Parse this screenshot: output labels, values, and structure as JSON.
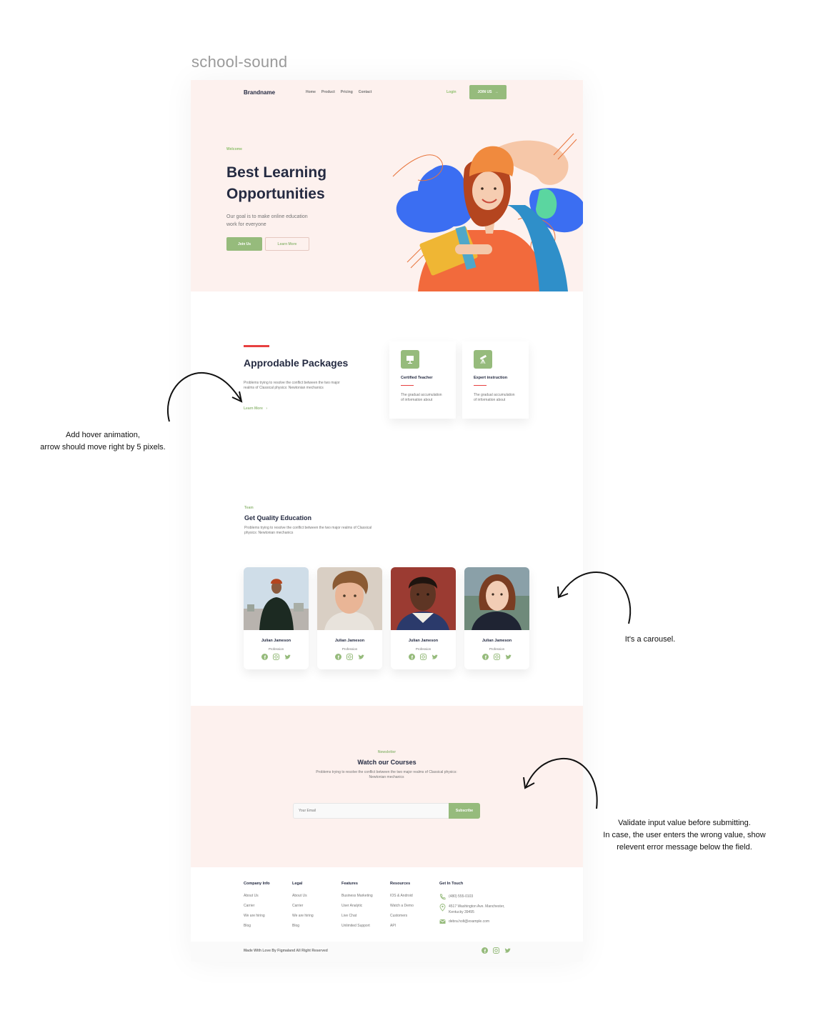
{
  "project_title": "school-sound",
  "header": {
    "brand": "Brandname",
    "nav": [
      "Home",
      "Product",
      "Pricing",
      "Contact"
    ],
    "login": "Login",
    "join_label": "JOIN US",
    "join_arrow": "→"
  },
  "hero": {
    "tag": "Welcome",
    "title_line1": "Best Learning",
    "title_line2": "Opportunities",
    "subtitle": "Our goal is to make online education work for everyone",
    "primary_button": "Join Us",
    "secondary_button": "Learn More"
  },
  "packages": {
    "title": "Approdable Packages",
    "subtitle": "Problems trying to resolve the conflict between the two major realms of Classical physics: Newtonian mechanics",
    "link": "Learn More",
    "link_arrow": "›",
    "cards": [
      {
        "icon": "presentation-board-icon",
        "title": "Certified Teacher",
        "text": "The gradual accumulation of information about"
      },
      {
        "icon": "telescope-icon",
        "title": "Expert instruction",
        "text": "The gradual accumulation of information about"
      }
    ]
  },
  "team": {
    "tag": "Team",
    "title": "Get Quality Education",
    "subtitle": "Problems trying to resolve the conflict between the two major realms of Classical physics: Newtonian mechanics",
    "members": [
      {
        "name": "Julian Jameson",
        "role": "Profession"
      },
      {
        "name": "Julian Jameson",
        "role": "Profession"
      },
      {
        "name": "Julian Jameson",
        "role": "Profession"
      },
      {
        "name": "Julian Jameson",
        "role": "Profession"
      }
    ]
  },
  "newsletter": {
    "tag": "Newsletter",
    "title": "Watch our Courses",
    "subtitle": "Problems trying to resolve the conflict between the two major realms of Classical physics: Newtonian mechanics",
    "input_placeholder": "Your Email",
    "button": "Subscribe"
  },
  "footer": {
    "columns": [
      {
        "title": "Company Info",
        "links": [
          "About Us",
          "Carrier",
          "We are hiring",
          "Blog"
        ]
      },
      {
        "title": "Legal",
        "links": [
          "About Us",
          "Carrier",
          "We are hiring",
          "Blog"
        ]
      },
      {
        "title": "Features",
        "links": [
          "Business Marketing",
          "User Analytic",
          "Live Chat",
          "Unlimited Support"
        ]
      },
      {
        "title": "Resources",
        "links": [
          "IOS & Android",
          "Watch a Demo",
          "Customers",
          "API"
        ]
      }
    ],
    "contact": {
      "title": "Get In Touch",
      "phone": "(480) 555-0103",
      "address_line1": "4517 Washington Ave. Manchester,",
      "address_line2": "Kentucky 39495",
      "email": "debra.holt@example.com"
    },
    "copyright": "Made With Love By Figmaland All Right Reserved"
  },
  "annotations": {
    "hover_line1": "Add hover animation,",
    "hover_line2": "arrow should move right by 5 pixels.",
    "carousel": "It's a carousel.",
    "validate_line1": "Validate input value before submitting.",
    "validate_line2": "In case, the user enters the wrong value, show",
    "validate_line3": "relevent error message below the field."
  },
  "colors": {
    "accent_green": "#96bb7c",
    "accent_red": "#e74040",
    "hero_bg": "#fdf1ee",
    "text_dark": "#252b42",
    "text_muted": "#737373"
  }
}
